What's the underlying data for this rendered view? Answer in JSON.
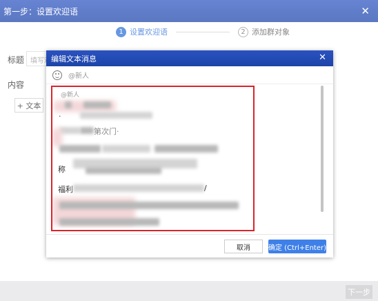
{
  "wizard": {
    "title": "第一步：设置欢迎语",
    "close_label": "✕",
    "steps": [
      {
        "number": "1",
        "label": "设置欢迎语",
        "active": true
      },
      {
        "number": "2",
        "label": "添加群对象",
        "active": false
      }
    ],
    "title_label": "标题",
    "title_placeholder": "填写欢",
    "content_label": "内容",
    "add_text_button": "+ 文本",
    "next_button": "下一步"
  },
  "modal": {
    "title": "编辑文本消息",
    "close_label": "✕",
    "toolbar": {
      "mention_label": "@新人"
    },
    "editor": {
      "mention_placeholder": "@新人",
      "visible_fragments": [
        "·",
        "第次门·",
        "",
        "称",
        "福利",
        "/"
      ]
    },
    "cancel_button": "取消",
    "confirm_button": "确定 (Ctrl+Enter)"
  }
}
